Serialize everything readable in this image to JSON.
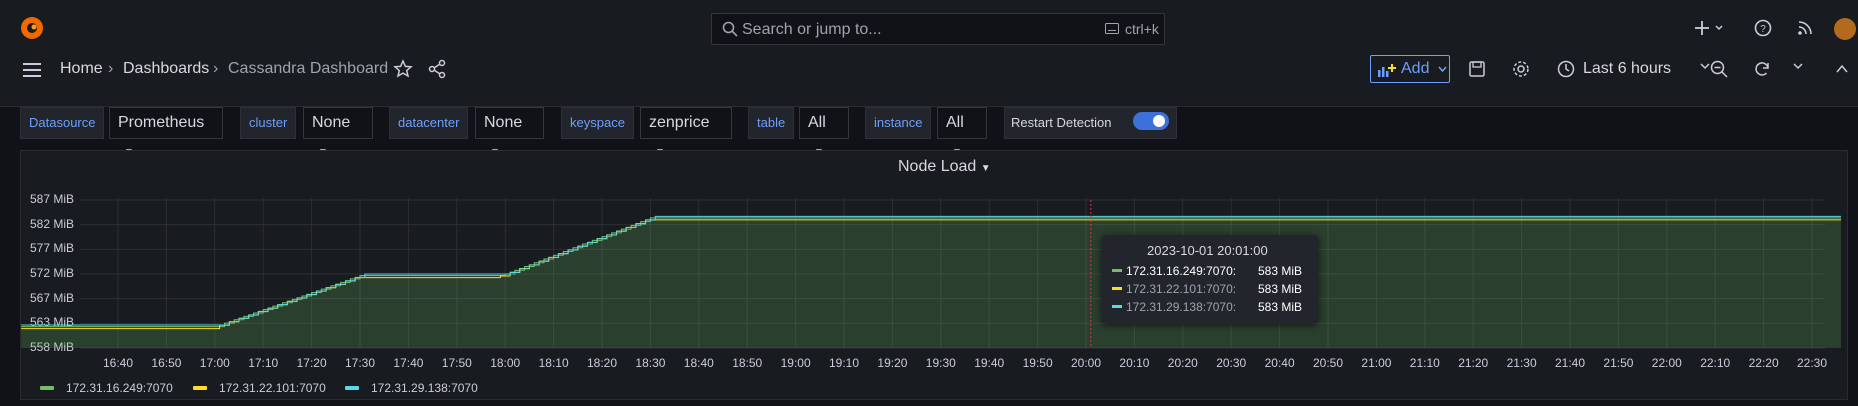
{
  "search": {
    "placeholder": "Search or jump to...",
    "shortcut": "ctrl+k"
  },
  "breadcrumb": {
    "home": "Home",
    "dashboards": "Dashboards",
    "current": "Cassandra Dashboard"
  },
  "toolbar": {
    "add_label": "Add",
    "time_range": "Last 6 hours"
  },
  "variables": [
    {
      "label": "Datasource",
      "value": "Prometheus"
    },
    {
      "label": "cluster",
      "value": "None"
    },
    {
      "label": "datacenter",
      "value": "None"
    },
    {
      "label": "keyspace",
      "value": "zenprice"
    },
    {
      "label": "table",
      "value": "All"
    },
    {
      "label": "instance",
      "value": "All"
    }
  ],
  "restart": {
    "label": "Restart Detection",
    "enabled": true
  },
  "panel": {
    "title": "Node Load"
  },
  "chart_data": {
    "type": "area",
    "title": "Node Load",
    "y_ticks": [
      "587 MiB",
      "582 MiB",
      "577 MiB",
      "572 MiB",
      "567 MiB",
      "563 MiB",
      "558 MiB"
    ],
    "x_ticks": [
      "16:40",
      "16:50",
      "17:00",
      "17:10",
      "17:20",
      "17:30",
      "17:40",
      "17:50",
      "18:00",
      "18:10",
      "18:20",
      "18:30",
      "18:40",
      "18:50",
      "19:00",
      "19:10",
      "19:20",
      "19:30",
      "19:40",
      "19:50",
      "20:00",
      "20:10",
      "20:20",
      "20:30",
      "20:40",
      "20:50",
      "21:00",
      "21:10",
      "21:20",
      "21:30",
      "21:40",
      "21:50",
      "22:00",
      "22:10",
      "22:20",
      "22:30"
    ],
    "series": [
      {
        "name": "172.31.16.249:7070",
        "color": "#73bf69"
      },
      {
        "name": "172.31.22.101:7070",
        "color": "#fade2a"
      },
      {
        "name": "172.31.29.138:7070",
        "color": "#5ad8e6"
      }
    ],
    "tooltip": {
      "time": "2023-10-01 20:01:00",
      "rows": [
        {
          "name": "172.31.16.249:7070:",
          "value": "583 MiB"
        },
        {
          "name": "172.31.22.101:7070:",
          "value": "583 MiB"
        },
        {
          "name": "172.31.29.138:7070:",
          "value": "583 MiB"
        }
      ]
    }
  }
}
